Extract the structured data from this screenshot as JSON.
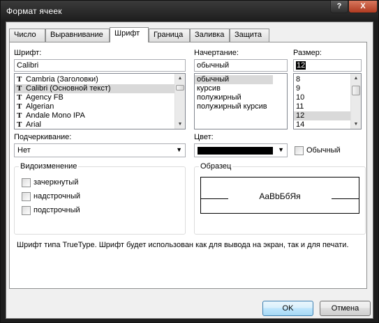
{
  "window": {
    "title": "Формат ячеек",
    "help": "?",
    "close": "X"
  },
  "tabs": [
    {
      "label": "Число"
    },
    {
      "label": "Выравнивание"
    },
    {
      "label": "Шрифт"
    },
    {
      "label": "Граница"
    },
    {
      "label": "Заливка"
    },
    {
      "label": "Защита"
    }
  ],
  "font": {
    "label": "Шрифт:",
    "value": "Calibri",
    "items": [
      {
        "name": "Cambria (Заголовки)"
      },
      {
        "name": "Calibri (Основной текст)",
        "selected": true
      },
      {
        "name": "Agency FB"
      },
      {
        "name": "Algerian"
      },
      {
        "name": "Andale Mono IPA"
      },
      {
        "name": "Arial"
      }
    ]
  },
  "style": {
    "label": "Начертание:",
    "value": "обычный",
    "items": [
      "обычный",
      "курсив",
      "полужирный",
      "полужирный курсив"
    ]
  },
  "size": {
    "label": "Размер:",
    "value": "12",
    "items": [
      "8",
      "9",
      "10",
      "11",
      "12",
      "14"
    ]
  },
  "underline": {
    "label": "Подчеркивание:",
    "value": "Нет"
  },
  "color": {
    "label": "Цвет:",
    "value": "#000000",
    "normal_label": "Обычный"
  },
  "effects": {
    "title": "Видоизменение",
    "strikethrough": "зачеркнутый",
    "superscript": "надстрочный",
    "subscript": "подстрочный"
  },
  "preview": {
    "title": "Образец",
    "sample": "AaBbБбЯя"
  },
  "hint": "Шрифт типа TrueType. Шрифт будет использован как для вывода на экран, так и для печати.",
  "buttons": {
    "ok": "OK",
    "cancel": "Отмена"
  }
}
